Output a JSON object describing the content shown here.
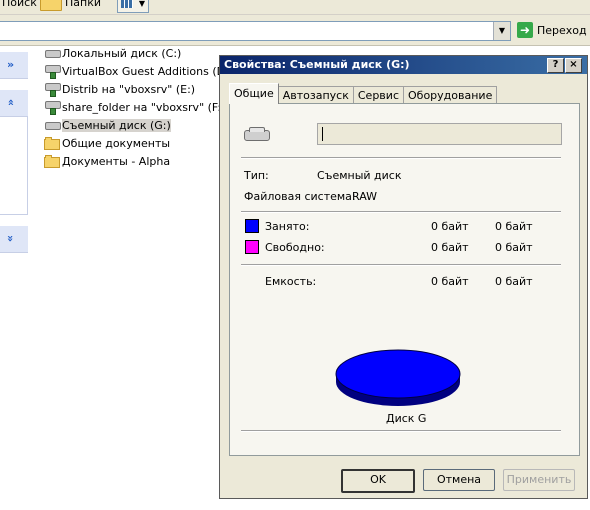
{
  "toolbar": {
    "search_label": "Поиск",
    "folders_label": "Папки"
  },
  "address": {
    "go_label": "Переход"
  },
  "tree": {
    "items": [
      {
        "label": "Локальный диск (C:)",
        "icon": "drive-icon"
      },
      {
        "label": "VirtualBox Guest Additions (D:)",
        "icon": "netdrive-icon"
      },
      {
        "label": "Distrib на \"vboxsrv\" (E:)",
        "icon": "netdrive-icon"
      },
      {
        "label": "share_folder на \"vboxsrv\" (F:)",
        "icon": "netdrive-icon"
      },
      {
        "label": "Съемный диск (G:)",
        "icon": "drive-icon",
        "selected": true
      },
      {
        "label": "Общие документы",
        "icon": "folder-icon"
      },
      {
        "label": "Документы - Alpha",
        "icon": "folder-icon"
      }
    ]
  },
  "dialog": {
    "title": "Свойства: Съемный диск (G:)",
    "help": "?",
    "close": "×",
    "tabs": [
      "Общие",
      "Автозапуск",
      "Сервис",
      "Оборудование"
    ],
    "active_tab": 0,
    "name_value": "",
    "type_label": "Тип:",
    "type_value": "Съемный диск",
    "fs_label": "Файловая система:",
    "fs_value": "RAW",
    "used": {
      "label": "Занято:",
      "bytes": "0 байт",
      "size": "0 байт",
      "color": "#0000ff"
    },
    "free": {
      "label": "Свободно:",
      "bytes": "0 байт",
      "size": "0 байт",
      "color": "#ff00ff"
    },
    "capacity": {
      "label": "Емкость:",
      "bytes": "0 байт",
      "size": "0 байт"
    },
    "pie_color": "#0000ff",
    "disk_label": "Диск G",
    "buttons": {
      "ok": "OK",
      "cancel": "Отмена",
      "apply": "Применить"
    }
  }
}
